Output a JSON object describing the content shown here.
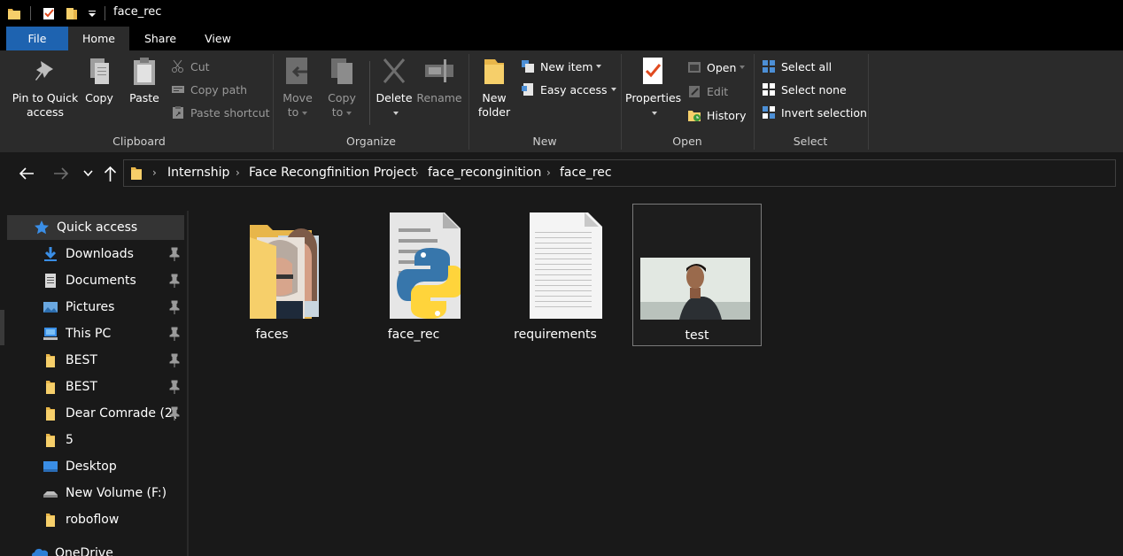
{
  "window": {
    "title": "face_rec"
  },
  "tabs": [
    "File",
    "Home",
    "Share",
    "View"
  ],
  "ribbon": {
    "clipboard": {
      "pin_label_1": "Pin to Quick",
      "pin_label_2": "access",
      "copy": "Copy",
      "paste": "Paste",
      "cut": "Cut",
      "copy_path": "Copy path",
      "paste_shortcut": "Paste shortcut",
      "group": "Clipboard"
    },
    "organize": {
      "move_1": "Move",
      "move_2": "to",
      "copy_1": "Copy",
      "copy_2": "to",
      "delete": "Delete",
      "rename": "Rename",
      "group": "Organize"
    },
    "new": {
      "new_folder_1": "New",
      "new_folder_2": "folder",
      "new_item": "New item",
      "easy_access": "Easy access",
      "group": "New"
    },
    "open": {
      "properties": "Properties",
      "open": "Open",
      "edit": "Edit",
      "history": "History",
      "group": "Open"
    },
    "select": {
      "select_all": "Select all",
      "select_none": "Select none",
      "invert": "Invert selection",
      "group": "Select"
    }
  },
  "breadcrumb": [
    "Internship",
    "Face Recongfinition Project",
    "face_reconginition",
    "face_rec"
  ],
  "sidebar": {
    "items": [
      {
        "label": "Quick access",
        "icon": "star-icon",
        "pinned": false
      },
      {
        "label": "Downloads",
        "icon": "download-icon",
        "pinned": true
      },
      {
        "label": "Documents",
        "icon": "document-icon",
        "pinned": true
      },
      {
        "label": "Pictures",
        "icon": "pictures-icon",
        "pinned": true
      },
      {
        "label": "This PC",
        "icon": "computer-icon",
        "pinned": true
      },
      {
        "label": "BEST",
        "icon": "folder-icon",
        "pinned": true
      },
      {
        "label": "BEST",
        "icon": "folder-icon",
        "pinned": true
      },
      {
        "label": "Dear Comrade (2(",
        "icon": "folder-icon",
        "pinned": true
      },
      {
        "label": "5",
        "icon": "folder-icon",
        "pinned": false
      },
      {
        "label": "Desktop",
        "icon": "desktop-icon",
        "pinned": false
      },
      {
        "label": "New Volume (F:)",
        "icon": "drive-icon",
        "pinned": false
      },
      {
        "label": "roboflow",
        "icon": "folder-icon",
        "pinned": false
      },
      {
        "label": "OneDrive",
        "icon": "cloud-icon",
        "pinned": false
      }
    ]
  },
  "files": [
    {
      "name": "faces",
      "type": "folder"
    },
    {
      "name": "face_rec",
      "type": "python"
    },
    {
      "name": "requirements",
      "type": "text"
    },
    {
      "name": "test",
      "type": "image",
      "selected": true
    }
  ],
  "colors": {
    "accent": "#1e63b0",
    "folder": "#f4c15b",
    "background": "#191919",
    "ribbon": "#2b2b2b"
  }
}
